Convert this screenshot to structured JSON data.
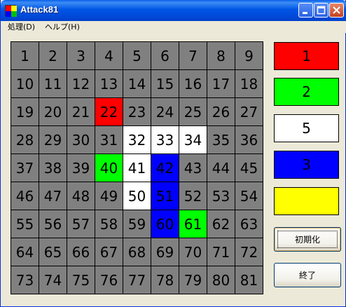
{
  "window": {
    "title": "Attack81"
  },
  "menu": [
    {
      "label": "処理(D)"
    },
    {
      "label": "ヘルプ(H)"
    }
  ],
  "board": {
    "cells": [
      {
        "n": "1",
        "c": "gray"
      },
      {
        "n": "2",
        "c": "gray"
      },
      {
        "n": "3",
        "c": "gray"
      },
      {
        "n": "4",
        "c": "gray"
      },
      {
        "n": "5",
        "c": "gray"
      },
      {
        "n": "6",
        "c": "gray"
      },
      {
        "n": "7",
        "c": "gray"
      },
      {
        "n": "8",
        "c": "gray"
      },
      {
        "n": "9",
        "c": "gray"
      },
      {
        "n": "10",
        "c": "gray"
      },
      {
        "n": "11",
        "c": "gray"
      },
      {
        "n": "12",
        "c": "gray"
      },
      {
        "n": "13",
        "c": "gray"
      },
      {
        "n": "14",
        "c": "gray"
      },
      {
        "n": "15",
        "c": "gray"
      },
      {
        "n": "16",
        "c": "gray"
      },
      {
        "n": "17",
        "c": "gray"
      },
      {
        "n": "18",
        "c": "gray"
      },
      {
        "n": "19",
        "c": "gray"
      },
      {
        "n": "20",
        "c": "gray"
      },
      {
        "n": "21",
        "c": "gray"
      },
      {
        "n": "22",
        "c": "red"
      },
      {
        "n": "23",
        "c": "gray"
      },
      {
        "n": "24",
        "c": "gray"
      },
      {
        "n": "25",
        "c": "gray"
      },
      {
        "n": "26",
        "c": "gray"
      },
      {
        "n": "27",
        "c": "gray"
      },
      {
        "n": "28",
        "c": "gray"
      },
      {
        "n": "29",
        "c": "gray"
      },
      {
        "n": "30",
        "c": "gray"
      },
      {
        "n": "31",
        "c": "gray"
      },
      {
        "n": "32",
        "c": "white"
      },
      {
        "n": "33",
        "c": "white"
      },
      {
        "n": "34",
        "c": "white"
      },
      {
        "n": "35",
        "c": "gray"
      },
      {
        "n": "36",
        "c": "gray"
      },
      {
        "n": "37",
        "c": "gray"
      },
      {
        "n": "38",
        "c": "gray"
      },
      {
        "n": "39",
        "c": "gray"
      },
      {
        "n": "40",
        "c": "green"
      },
      {
        "n": "41",
        "c": "white"
      },
      {
        "n": "42",
        "c": "blue"
      },
      {
        "n": "43",
        "c": "gray"
      },
      {
        "n": "44",
        "c": "gray"
      },
      {
        "n": "45",
        "c": "gray"
      },
      {
        "n": "46",
        "c": "gray"
      },
      {
        "n": "47",
        "c": "gray"
      },
      {
        "n": "48",
        "c": "gray"
      },
      {
        "n": "49",
        "c": "gray"
      },
      {
        "n": "50",
        "c": "white"
      },
      {
        "n": "51",
        "c": "blue"
      },
      {
        "n": "52",
        "c": "gray"
      },
      {
        "n": "53",
        "c": "gray"
      },
      {
        "n": "54",
        "c": "gray"
      },
      {
        "n": "55",
        "c": "gray"
      },
      {
        "n": "56",
        "c": "gray"
      },
      {
        "n": "57",
        "c": "gray"
      },
      {
        "n": "58",
        "c": "gray"
      },
      {
        "n": "59",
        "c": "gray"
      },
      {
        "n": "60",
        "c": "blue"
      },
      {
        "n": "61",
        "c": "green"
      },
      {
        "n": "62",
        "c": "gray"
      },
      {
        "n": "63",
        "c": "gray"
      },
      {
        "n": "64",
        "c": "gray"
      },
      {
        "n": "65",
        "c": "gray"
      },
      {
        "n": "66",
        "c": "gray"
      },
      {
        "n": "67",
        "c": "gray"
      },
      {
        "n": "68",
        "c": "gray"
      },
      {
        "n": "69",
        "c": "gray"
      },
      {
        "n": "70",
        "c": "gray"
      },
      {
        "n": "71",
        "c": "gray"
      },
      {
        "n": "72",
        "c": "gray"
      },
      {
        "n": "73",
        "c": "gray"
      },
      {
        "n": "74",
        "c": "gray"
      },
      {
        "n": "75",
        "c": "gray"
      },
      {
        "n": "76",
        "c": "gray"
      },
      {
        "n": "77",
        "c": "gray"
      },
      {
        "n": "78",
        "c": "gray"
      },
      {
        "n": "79",
        "c": "gray"
      },
      {
        "n": "80",
        "c": "gray"
      },
      {
        "n": "81",
        "c": "gray"
      }
    ]
  },
  "colors": {
    "gray": "#808080",
    "red": "#FF0000",
    "green": "#00FF00",
    "white": "#FFFFFF",
    "blue": "#0000FF",
    "yellow": "#FFFF00"
  },
  "side_panel": {
    "swatches": [
      {
        "label": "1",
        "color": "red"
      },
      {
        "label": "2",
        "color": "green"
      },
      {
        "label": "5",
        "color": "white"
      },
      {
        "label": "3",
        "color": "blue"
      },
      {
        "label": "",
        "color": "yellow"
      }
    ],
    "init_button": "初期化",
    "exit_button": "終了"
  }
}
